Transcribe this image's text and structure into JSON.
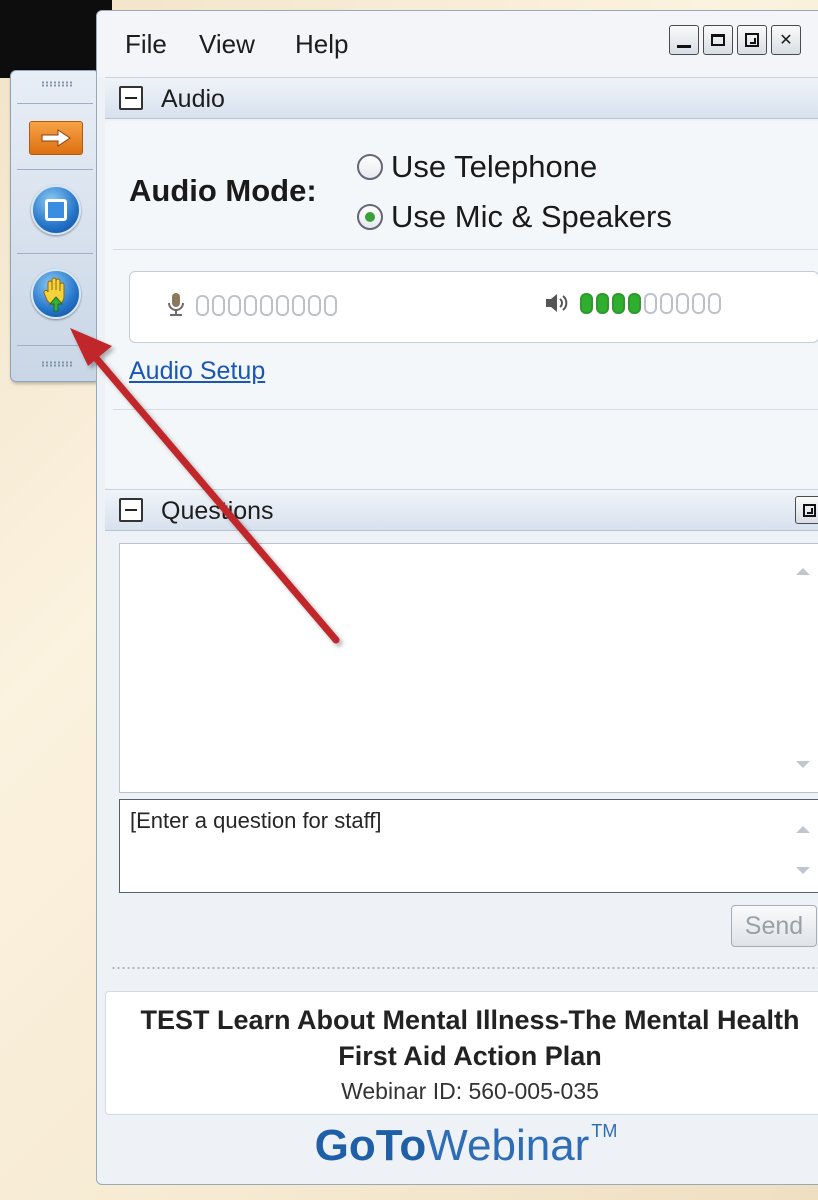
{
  "menu": [
    "File",
    "View",
    "Help"
  ],
  "window_controls": [
    "minimize",
    "maximize",
    "restore",
    "close"
  ],
  "toolbar": {
    "buttons": [
      {
        "icon": "orange-arrow-icon"
      },
      {
        "icon": "screen-square-icon"
      },
      {
        "icon": "raise-hand-icon"
      }
    ]
  },
  "audio": {
    "section_title": "Audio",
    "mode_label": "Audio Mode:",
    "options": [
      {
        "label": "Use Telephone",
        "selected": false
      },
      {
        "label": "Use Mic & Speakers",
        "selected": true
      }
    ],
    "mic_level": 0,
    "speaker_level": 4,
    "meter_segments": 9,
    "setup_link": "Audio Setup"
  },
  "questions": {
    "section_title": "Questions",
    "input_value": "[Enter a question for staff]",
    "send_label": "Send"
  },
  "webinar": {
    "title": "TEST Learn About Mental Illness-The Mental Health First Aid Action Plan",
    "id_text": "Webinar ID: 560-005-035"
  },
  "brand": {
    "go": "Go",
    "to": "To",
    "webinar": "Webinar",
    "tm": "TM"
  },
  "colors": {
    "accent": "#1f5fa8",
    "level_on": "#2fae2f",
    "arrow": "#c0262b"
  }
}
